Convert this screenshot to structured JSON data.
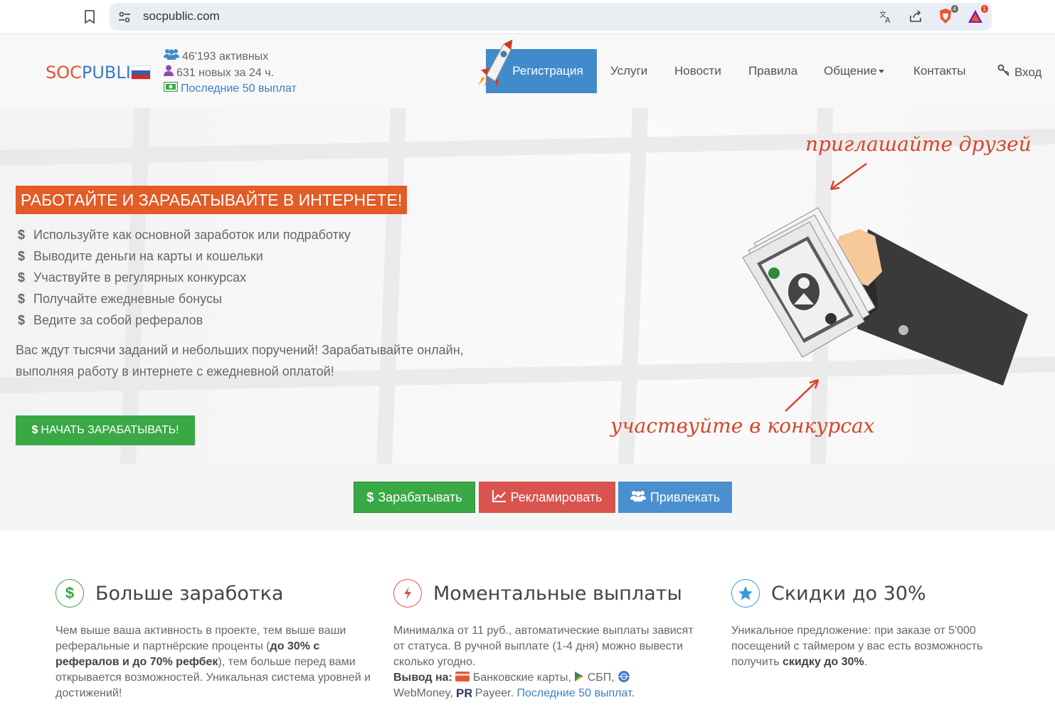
{
  "browser": {
    "url": "socpublic.com",
    "brave_badge": "4",
    "rewards_badge": "1"
  },
  "header": {
    "logo_part1": "SOC",
    "logo_part2": "PUBLIC",
    "stats": {
      "active": "46'193 активных",
      "new_24h": "631 новых за 24 ч.",
      "payouts_link": "Последние 50 выплат"
    },
    "nav": {
      "register": "Регистрация",
      "services": "Услуги",
      "news": "Новости",
      "rules": "Правила",
      "chat": "Общение",
      "contacts": "Контакты",
      "login": "Вход"
    }
  },
  "hero": {
    "title": "РАБОТАЙТЕ И ЗАРАБАТЫВАЙТЕ В ИНТЕРНЕТЕ!",
    "bullets": [
      "Используйте как основной заработок или подработку",
      "Выводите деньги на карты и кошельки",
      "Участвуйте в регулярных конкурсах",
      "Получайте ежедневные бонусы",
      "Ведите за собой рефералов"
    ],
    "description": "Вас ждут тысячи заданий и небольших поручений! Зарабатывайте онлайн, выполняя работу в интернете с ежедневной оплатой!",
    "start_button": "НАЧАТЬ ЗАРАБАТЫВАТЬ!",
    "caption_invite": "приглашайте друзей",
    "caption_contests": "участвуйте в конкурсах"
  },
  "tabs": {
    "earn": "Зарабатывать",
    "advertise": "Рекламировать",
    "attract": "Привлекать"
  },
  "features": [
    {
      "title": "Больше заработка",
      "text_1": "Чем выше ваша активность в проекте, тем выше ваши реферальные и партнёрские проценты (",
      "text_bold": "до 30% с рефералов и до 70% рефбек",
      "text_2": "), тем больше перед вами открывается возможностей. Уникальная система уровней и достижений!"
    },
    {
      "title": "Моментальные выплаты",
      "text_1": "Минималка от 11 руб., автоматические выплаты зависят от статуса. В ручной выплате (1-4 дня) можно вывести сколько угодно.",
      "withdraw_label": "Вывод на:",
      "method_cards": "Банковские карты,",
      "method_sbp": "СБП,",
      "method_webmoney": "WebMoney,",
      "method_payeer": "Payeer.",
      "payouts_link": "Последние 50 выплат",
      "text_end": "."
    },
    {
      "title": "Скидки до 30%",
      "text_1": "Уникальное предложение: при заказе от 5'000 посещений с таймером у вас есть возможность получить ",
      "text_bold": "скидку до 30%",
      "text_2": "."
    }
  ],
  "colors": {
    "accent_blue": "#428bca",
    "hero_orange": "#e35b26",
    "green": "#39a845",
    "red": "#d9534f"
  }
}
